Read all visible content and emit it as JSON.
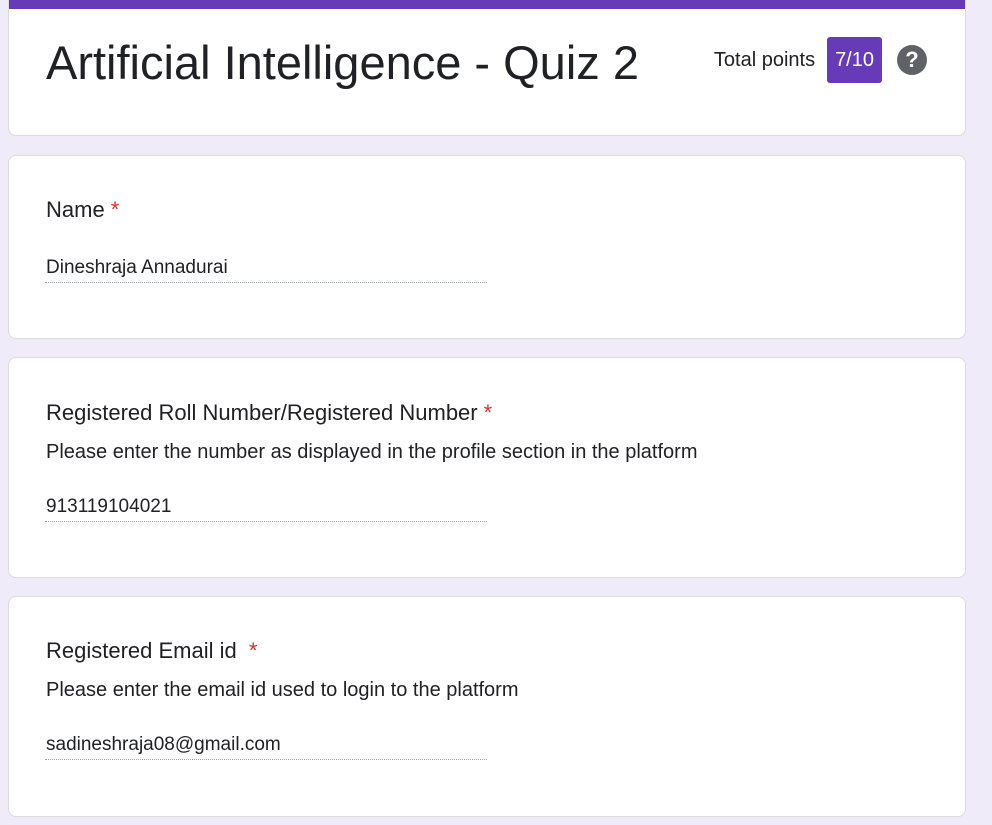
{
  "form": {
    "title": "Artificial Intelligence - Quiz 2",
    "score_label": "Total points",
    "score_value": "7/10",
    "help_icon": "help-circle-icon",
    "accent_color": "#673ab7",
    "background_color": "#f0ebf8",
    "required_color": "#d93025"
  },
  "questions": [
    {
      "title": "Name",
      "required_mark": "*",
      "description": "",
      "answer": "Dineshraja Annadurai"
    },
    {
      "title": "Registered Roll Number/Registered Number",
      "required_mark": "*",
      "description": "Please enter the number as displayed in the profile section in the platform",
      "answer": "913119104021"
    },
    {
      "title": "Registered Email id ",
      "required_mark": "*",
      "description": "Please enter the email id used to login to the platform",
      "answer": "sadineshraja08@gmail.com"
    }
  ]
}
